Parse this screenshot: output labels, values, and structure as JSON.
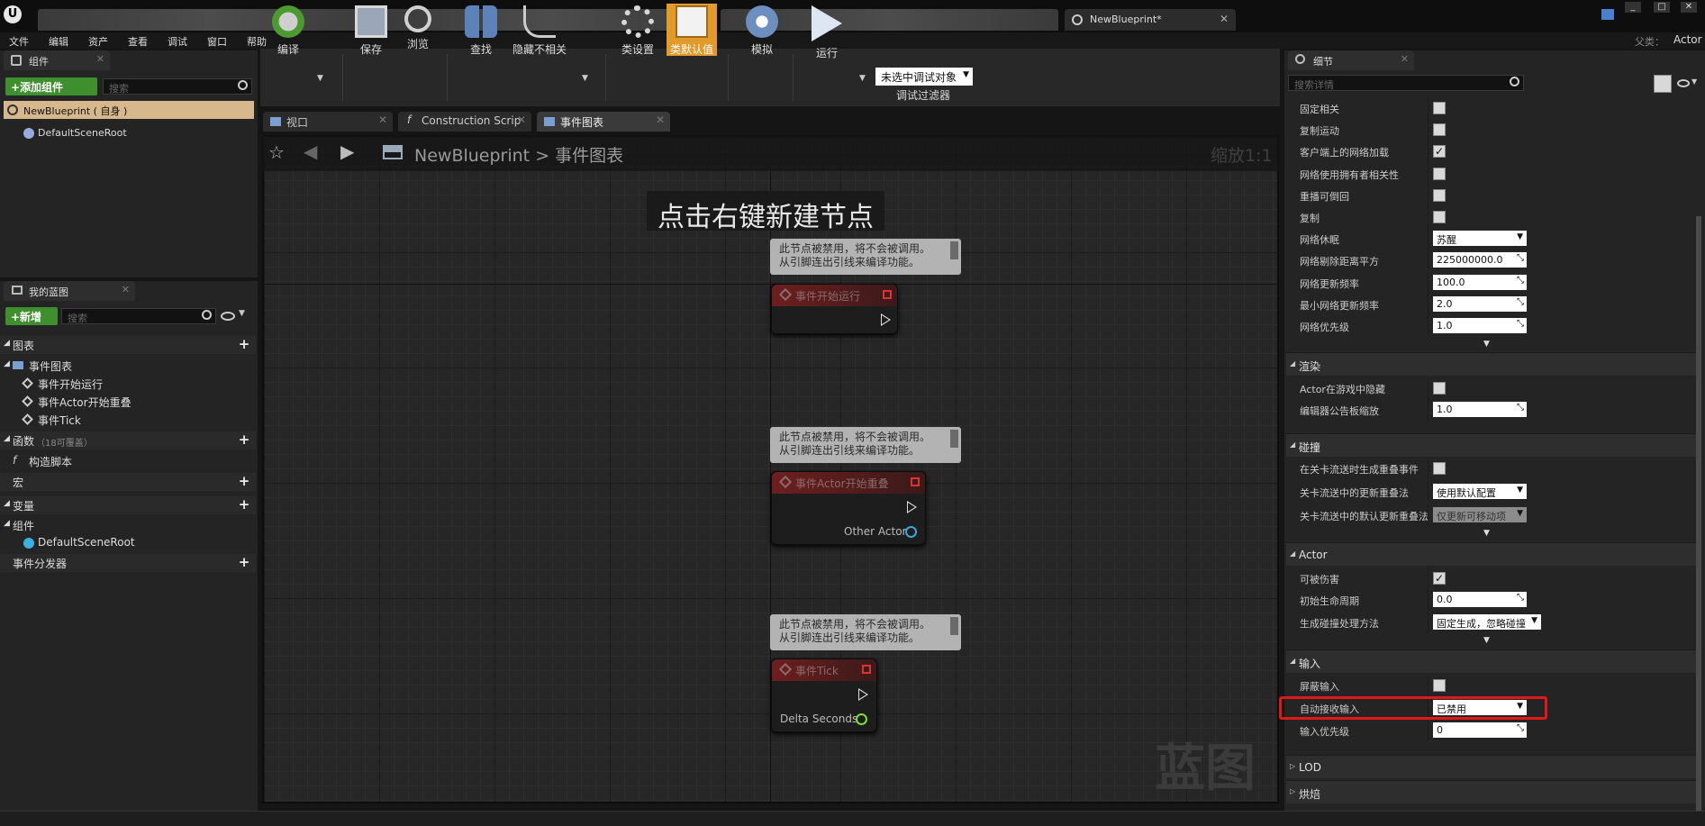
{
  "window": {
    "active_tab": "NewBlueprint*",
    "parent_class_label": "父类：",
    "parent_class_value": "Actor"
  },
  "menu": [
    "文件",
    "编辑",
    "资产",
    "查看",
    "调试",
    "窗口",
    "帮助"
  ],
  "components_panel": {
    "tab": "组件",
    "add_button": "+添加组件",
    "search_placeholder": "搜索",
    "root_item": "NewBlueprint ( 自身 )",
    "child_item": "DefaultSceneRoot"
  },
  "my_blueprint": {
    "tab": "我的蓝图",
    "new_button": "+新增",
    "search_placeholder": "搜索",
    "graphs_header": "图表",
    "event_graph": "事件图表",
    "events": [
      "事件开始运行",
      "事件Actor开始重叠",
      "事件Tick"
    ],
    "functions_header": "函数",
    "functions_overridable": "（18可覆盖）",
    "construction_script": "构造脚本",
    "macros_header": "宏",
    "variables_header": "变量",
    "components_header": "组件",
    "component_item": "DefaultSceneRoot",
    "dispatchers_header": "事件分发器"
  },
  "toolbar": {
    "compile": "编译",
    "save": "保存",
    "browse": "浏览",
    "find": "查找",
    "hide_unrelated": "隐藏不相关",
    "class_settings": "类设置",
    "class_defaults": "类默认值",
    "simulate": "模拟",
    "play": "运行",
    "debug_object": "未选中调试对象",
    "debug_filter": "调试过滤器"
  },
  "editor_tabs": [
    "视口",
    "Construction Scrip",
    "事件图表"
  ],
  "graph": {
    "breadcrumb_root": "NewBlueprint",
    "breadcrumb_sep": ">",
    "breadcrumb_current": "事件图表",
    "zoom": "缩放1:1",
    "hint": "点击右键新建节点",
    "watermark": "蓝图",
    "disabled_note_line1": "此节点被禁用，将不会被调用。",
    "disabled_note_line2": "从引脚连出引线来编译功能。",
    "nodes": [
      {
        "title": "事件开始运行",
        "pins": []
      },
      {
        "title": "事件Actor开始重叠",
        "pins": [
          "Other Actor"
        ]
      },
      {
        "title": "事件Tick",
        "pins": [
          "Delta Seconds"
        ]
      }
    ]
  },
  "details": {
    "tab": "细节",
    "search_placeholder": "搜索详情",
    "replication_rows": [
      {
        "label": "固定相关",
        "type": "checkbox",
        "checked": false
      },
      {
        "label": "复制运动",
        "type": "checkbox",
        "checked": false
      },
      {
        "label": "客户端上的网络加载",
        "type": "checkbox",
        "checked": true
      },
      {
        "label": "网络使用拥有者相关性",
        "type": "checkbox",
        "checked": false
      },
      {
        "label": "重播可倒回",
        "type": "checkbox",
        "checked": false
      },
      {
        "label": "复制",
        "type": "checkbox",
        "checked": false
      },
      {
        "label": "网络休眠",
        "type": "dropdown",
        "value": "苏醒"
      },
      {
        "label": "网络剔除距离平方",
        "type": "number",
        "value": "225000000.0"
      },
      {
        "label": "网络更新频率",
        "type": "number",
        "value": "100.0"
      },
      {
        "label": "最小网络更新频率",
        "type": "number",
        "value": "2.0"
      },
      {
        "label": "网络优先级",
        "type": "number",
        "value": "1.0"
      }
    ],
    "rendering": {
      "header": "渲染",
      "rows": [
        {
          "label": "Actor在游戏中隐藏",
          "type": "checkbox",
          "checked": false
        },
        {
          "label": "编辑器公告板缩放",
          "type": "number",
          "value": "1.0"
        }
      ]
    },
    "collision": {
      "header": "碰撞",
      "rows": [
        {
          "label": "在关卡流送时生成重叠事件",
          "type": "checkbox",
          "checked": false
        },
        {
          "label": "关卡流送中的更新重叠法",
          "type": "dropdown",
          "value": "使用默认配置"
        },
        {
          "label": "关卡流送中的默认更新重叠法",
          "type": "dropdown",
          "value": "仅更新可移动项"
        }
      ]
    },
    "actor": {
      "header": "Actor",
      "rows": [
        {
          "label": "可被伤害",
          "type": "checkbox",
          "checked": true
        },
        {
          "label": "初始生命周期",
          "type": "number",
          "value": "0.0"
        },
        {
          "label": "生成碰撞处理方法",
          "type": "dropdown",
          "value": "固定生成，忽略碰撞"
        }
      ]
    },
    "input": {
      "header": "输入",
      "rows": [
        {
          "label": "屏蔽输入",
          "type": "checkbox",
          "checked": false
        },
        {
          "label": "自动接收输入",
          "type": "dropdown",
          "value": "已禁用"
        },
        {
          "label": "输入优先级",
          "type": "number",
          "value": "0"
        }
      ]
    },
    "lod_header": "LOD",
    "bake_header": "烘焙"
  },
  "colors": {
    "accent_orange": "#e29a2a",
    "add_green": "#3f8f2f",
    "highlight_red": "#e01818",
    "event_node_red": "#6e1e1e"
  }
}
